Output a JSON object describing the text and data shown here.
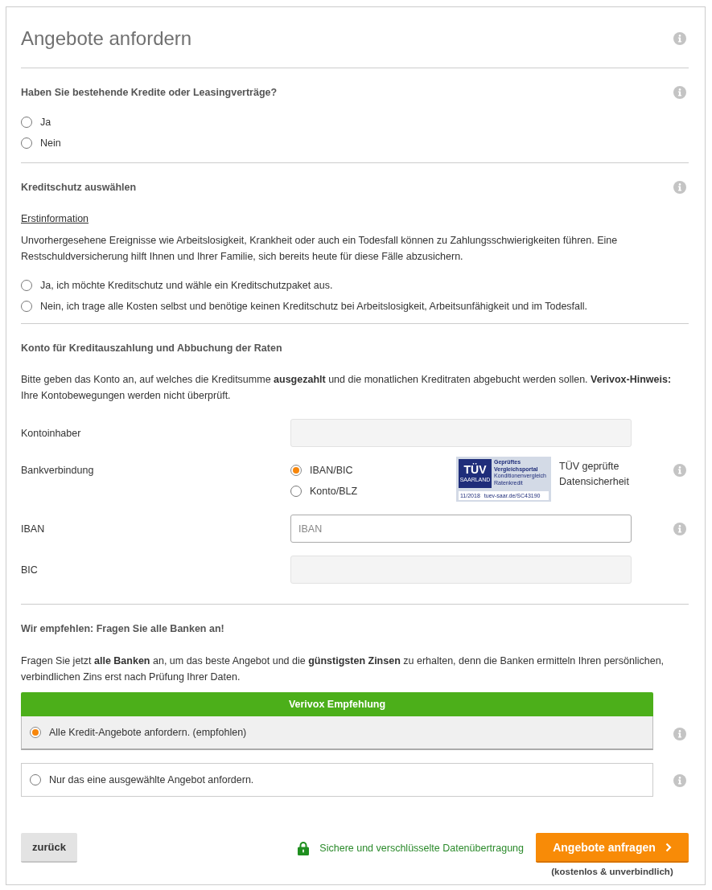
{
  "header": {
    "title": "Angebote anfordern",
    "info": true
  },
  "sections": [
    {
      "kind": "question",
      "heading": "Haben Sie bestehende Kredite oder Leasingverträge?",
      "info": true,
      "options": [
        {
          "label": "Ja",
          "selected": false
        },
        {
          "label": "Nein",
          "selected": false
        }
      ]
    },
    {
      "kind": "insurance",
      "heading": "Kreditschutz auswählen",
      "info": true,
      "link": "Erstinformation",
      "text": "Unvorhergesehene Ereignisse wie Arbeitslosigkeit, Krankheit oder auch ein Todesfall können zu Zahlungsschwierigkeiten führen. Eine Restschuldversicherung hilft Ihnen und Ihrer Familie, sich bereits heute für diese Fälle abzusichern.",
      "options": [
        {
          "label": "Ja, ich möchte Kreditschutz und wähle ein Kreditschutzpaket aus.",
          "selected": false
        },
        {
          "label": "Nein, ich trage alle Kosten selbst und benötige keinen Kreditschutz bei Arbeitslosigkeit, Arbeitsunfähigkeit und im Todesfall.",
          "selected": false
        }
      ]
    },
    {
      "kind": "account",
      "heading": "Konto für Kreditauszahlung und Abbuchung der Raten",
      "info": false,
      "text": "Bitte geben das Konto an, auf welches die Kreditsumme **ausgezahlt** und die monatlichen Kreditraten abgebucht werden sollen. **Verivox-Hinweis:** Ihre Kontobewegungen werden nicht überprüft.",
      "fields": [
        {
          "kind": "text_input",
          "label": "Kontoinhaber",
          "disabled": true,
          "info": false
        },
        {
          "kind": "radio_group",
          "label": "Bankverbindung",
          "info": true,
          "options": [
            {
              "label": "IBAN/BIC",
              "selected": true
            },
            {
              "label": "Konto/BLZ",
              "selected": false
            }
          ],
          "seal": {
            "mark": "TÜV",
            "region": "SAARLAND",
            "lines": [
              "Geprüftes",
              "Vergleichsportal"
            ],
            "sublines": [
              "Konditionenvergleich",
              "Ratenkredit"
            ],
            "date": "11/2018",
            "url": "tuev-saar.de/SC43190"
          },
          "seal_caption": "TÜV geprüfte Datensicherheit"
        },
        {
          "kind": "text_input",
          "label": "IBAN",
          "placeholder": "IBAN",
          "disabled": false,
          "info": true
        },
        {
          "kind": "text_input",
          "label": "BIC",
          "disabled": true,
          "info": false
        }
      ]
    },
    {
      "kind": "recommendation",
      "heading": "Wir empfehlen: Fragen Sie alle Banken an!",
      "info": false,
      "text": "Fragen Sie jetzt **alle Banken** an, um das beste Angebot und die **günstigsten Zinsen** zu erhalten, denn die Banken ermitteln Ihren persönlichen, verbindlichen Zins erst nach Prüfung Ihrer Daten.",
      "choices": [
        {
          "banner": "Verivox Empfehlung",
          "label": "Alle Kredit-Angebote anfordern. (empfohlen)",
          "selected": true,
          "info": true
        },
        {
          "label": "Nur das eine ausgewählte Angebot anfordern.",
          "selected": false,
          "info": true
        }
      ]
    }
  ],
  "footer": {
    "back_button": "zurück",
    "secure_note": "Sichere und verschlüsselte Datenübertragung",
    "submit_button": "Angebote anfragen",
    "submit_note": "(kostenlos & unverbindlich)"
  }
}
